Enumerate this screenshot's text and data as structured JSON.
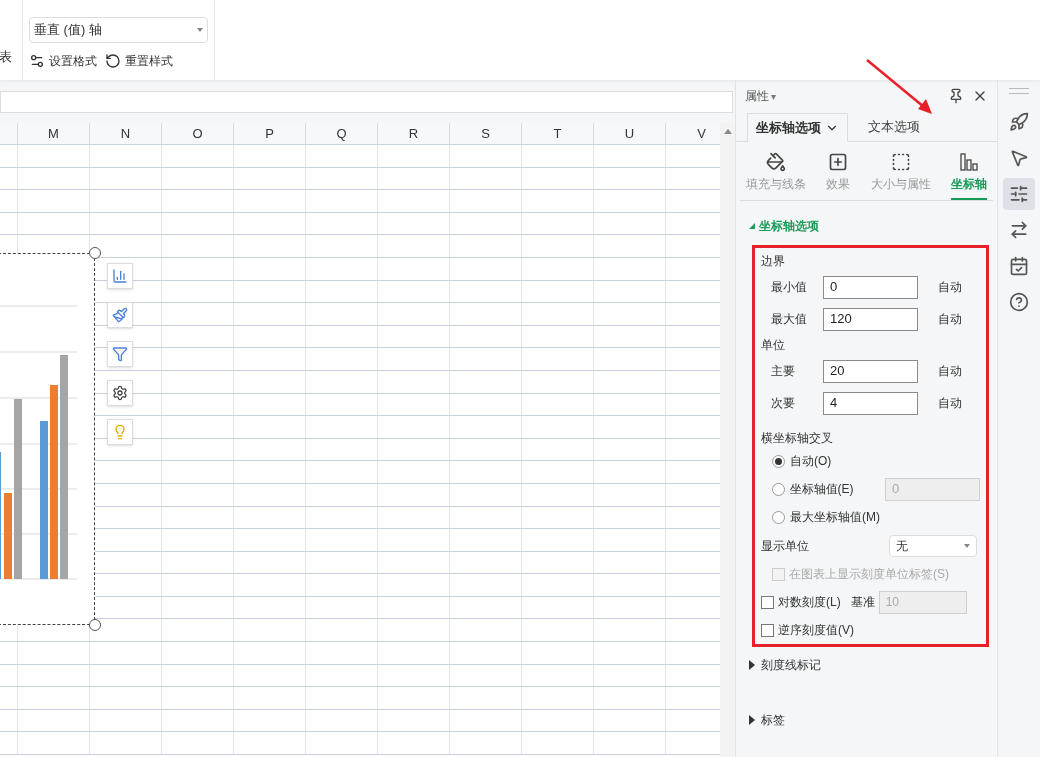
{
  "ribbon": {
    "cut_label": "表",
    "element_select": {
      "value": "垂直 (值) 轴"
    },
    "buttons": [
      {
        "label": "设置格式",
        "kind": "format"
      },
      {
        "label": "重置样式",
        "kind": "reset"
      }
    ]
  },
  "columns": [
    "M",
    "N",
    "O",
    "P",
    "Q",
    "R",
    "S",
    "T",
    "U",
    "V"
  ],
  "panel": {
    "title": "属性",
    "title_caret": "▾",
    "tabs": [
      {
        "label": "坐标轴选项",
        "selected": true
      },
      {
        "label": "文本选项",
        "selected": false
      }
    ],
    "categories": [
      {
        "label": "填充与线条",
        "kind": "fill",
        "selected": false
      },
      {
        "label": "效果",
        "kind": "effect",
        "selected": false
      },
      {
        "label": "大小与属性",
        "kind": "size",
        "selected": false
      },
      {
        "label": "坐标轴",
        "kind": "axis",
        "selected": true
      }
    ],
    "section": {
      "title": "坐标轴选项",
      "expanded": true
    },
    "bounds": {
      "title": "边界",
      "rows": [
        {
          "label": "最小值",
          "value": "0",
          "auto": "自动"
        },
        {
          "label": "最大值",
          "value": "120",
          "auto": "自动"
        }
      ]
    },
    "units": {
      "title": "单位",
      "rows": [
        {
          "label": "主要",
          "value": "20",
          "auto": "自动"
        },
        {
          "label": "次要",
          "value": "4",
          "auto": "自动"
        }
      ]
    },
    "cross": {
      "title": "横坐标轴交叉",
      "options": [
        {
          "label": "自动(O)",
          "selected": true
        },
        {
          "label": "坐标轴值(E)",
          "selected": false,
          "input": "0"
        },
        {
          "label": "最大坐标轴值(M)",
          "selected": false
        }
      ]
    },
    "display_unit": {
      "label": "显示单位",
      "value": "无"
    },
    "show_unit_label": {
      "label": "在图表上显示刻度单位标签(S)",
      "checked": false,
      "disabled": true
    },
    "log_scale": {
      "label": "对数刻度(L)",
      "checked": false,
      "base_label": "基准",
      "base_value": "10"
    },
    "reverse": {
      "label": "逆序刻度值(V)",
      "checked": false
    },
    "collapsed_sections": [
      {
        "label": "刻度线标记",
        "expanded": false
      },
      {
        "label": "标签",
        "expanded": false
      }
    ]
  },
  "side_tools": [
    {
      "kind": "rocket",
      "selected": false
    },
    {
      "kind": "pointer",
      "selected": false
    },
    {
      "kind": "sliders",
      "selected": true
    },
    {
      "kind": "transform",
      "selected": false
    },
    {
      "kind": "check",
      "selected": false
    },
    {
      "kind": "help",
      "selected": false
    }
  ]
}
